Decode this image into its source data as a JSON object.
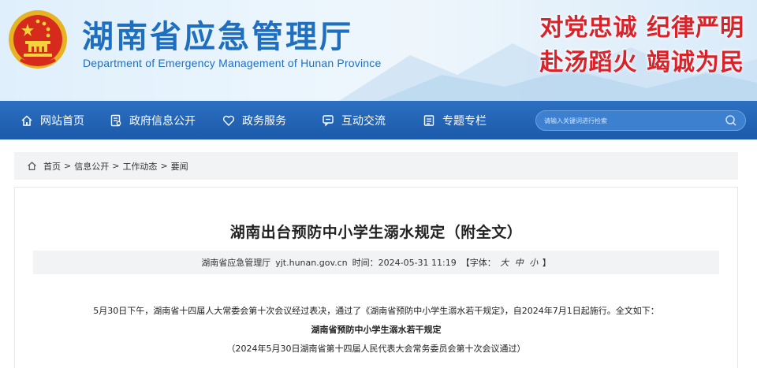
{
  "header": {
    "title": "湖南省应急管理厅",
    "subtitle": "Department of Emergency Management of Hunan Province",
    "slogan_line1": "对党忠诚  纪律严明",
    "slogan_line2": "赴汤蹈火  竭诚为民",
    "emblem_icon": "national-emblem-icon"
  },
  "nav": {
    "items": [
      {
        "label": "网站首页",
        "icon": "home-icon"
      },
      {
        "label": "政府信息公开",
        "icon": "document-icon"
      },
      {
        "label": "政务服务",
        "icon": "heart-icon"
      },
      {
        "label": "互动交流",
        "icon": "chat-icon"
      },
      {
        "label": "专题专栏",
        "icon": "list-icon"
      }
    ],
    "search_placeholder": "请输入关键词进行检索"
  },
  "breadcrumb": {
    "items": [
      "首页",
      "信息公开",
      "工作动态",
      "要闻"
    ],
    "separator": ">"
  },
  "article": {
    "title": "湖南出台预防中小学生溺水规定（附全文）",
    "source": "湖南省应急管理厅",
    "site": "yjt.hunan.gov.cn",
    "time_label": "时间：",
    "time": "2024-05-31 11:19",
    "font_label": "【字体：",
    "font_sizes": [
      "大",
      "中",
      "小"
    ],
    "font_close": "】",
    "paragraph": "5月30日下午，湖南省十四届人大常委会第十次会议经过表决，通过了《湖南省预防中小学生溺水若干规定》，自2024年7月1日起施行。全文如下：",
    "doc_title": "湖南省预防中小学生溺水若干规定",
    "doc_note": "（2024年5月30日湖南省第十四届人民代表大会常务委员会第十次会议通过）"
  },
  "colors": {
    "brand_blue": "#1f6fc1",
    "nav_blue": "#1c5aab",
    "slogan_red": "#d9232a"
  }
}
